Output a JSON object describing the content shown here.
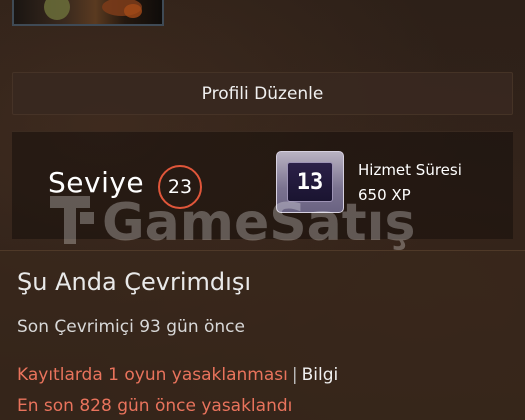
{
  "profile": {
    "edit_button_label": "Profili Düzenle"
  },
  "level": {
    "label": "Seviye",
    "value": "23"
  },
  "badge": {
    "number": "13",
    "title": "Hizmet Süresi",
    "xp": "650 XP"
  },
  "watermark": {
    "text": "GameSatış"
  },
  "status": {
    "title": "Şu Anda Çevrimdışı",
    "last_online": "Son Çevrimiçi 93 gün önce",
    "ban_record": "Kayıtlarda 1 oyun yasaklanması",
    "separator": "|",
    "info_link": "Bilgi",
    "ban_last": "En son 828 gün önce yasaklandı"
  },
  "colors": {
    "level_ring": "#e0563a",
    "ban_text": "#e9735c",
    "panel": "#3a281c"
  }
}
